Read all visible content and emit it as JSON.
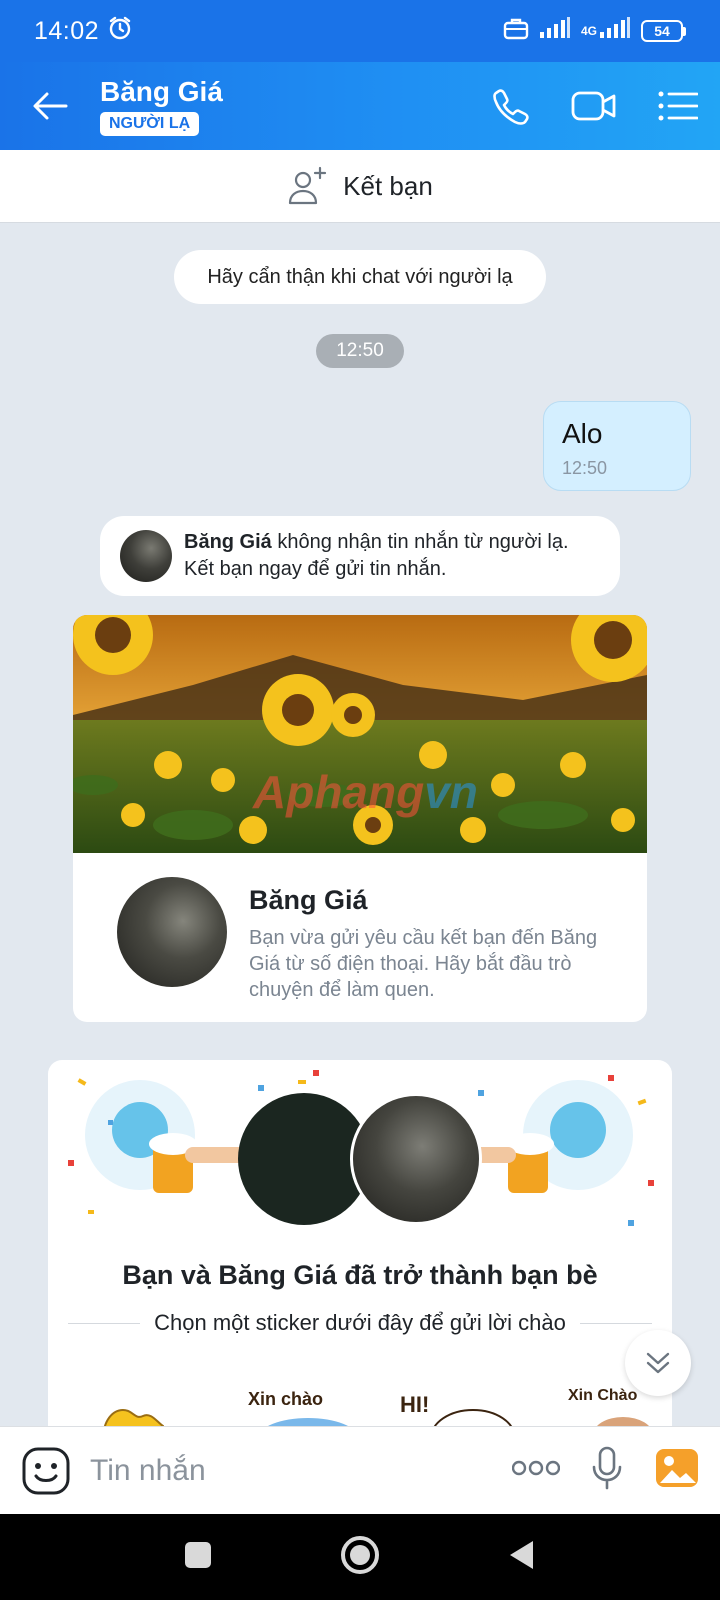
{
  "status_bar": {
    "time": "14:02",
    "network": "4G",
    "battery": "54"
  },
  "header": {
    "title": "Băng Giá",
    "badge": "NGƯỜI LẠ"
  },
  "add_friend_bar": {
    "label": "Kết bạn"
  },
  "chat": {
    "notice": "Hãy cẩn thận khi chat với người lạ",
    "time_divider": "12:50",
    "sent_message": {
      "text": "Alo",
      "time": "12:50"
    },
    "system_note": {
      "name": "Băng Giá",
      "line1_rest": " không nhận tin nhắn từ người lạ.",
      "line2": "Kết bạn ngay để gửi tin nhắn."
    },
    "profile_card": {
      "name": "Băng Giá",
      "description": "Bạn vừa gửi yêu cầu kết bạn đến Băng Giá từ số điện thoại. Hãy bắt đầu trò chuyện để làm quen."
    },
    "friend_card": {
      "title": "Bạn và Băng Giá đã trở thành bạn bè",
      "subtitle": "Chọn một sticker dưới đây để gửi lời chào",
      "stickers": [
        "Xin chào",
        "HI!",
        "Xin Chào"
      ]
    }
  },
  "composer": {
    "placeholder": "Tin nhắn"
  },
  "colors": {
    "brand": "#1a73e8",
    "chat_bg": "#e2e8ef",
    "sent_bubble": "#d4efff"
  }
}
